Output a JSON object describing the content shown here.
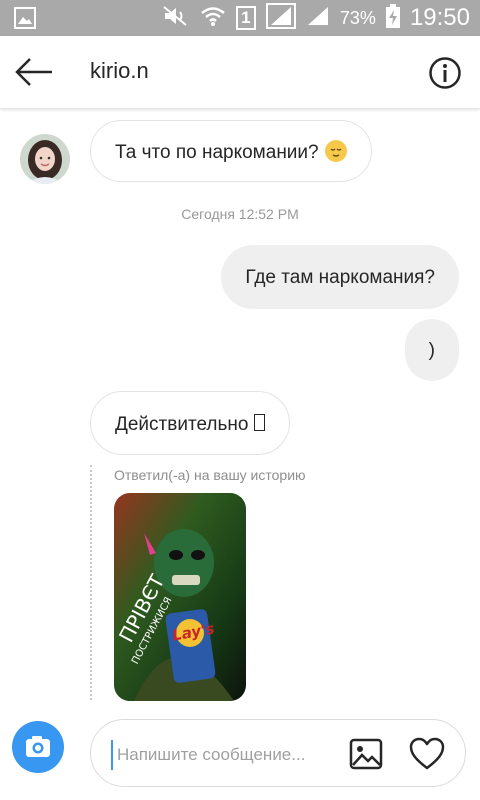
{
  "status_bar": {
    "battery_percent": "73%",
    "time": "19:50",
    "sim_slot": "1",
    "icons": [
      "image-icon",
      "mute-icon",
      "wifi-icon",
      "sim-icon",
      "signal-icon",
      "signal-icon",
      "battery-charging-icon"
    ]
  },
  "header": {
    "username": "kirio.n",
    "icons": [
      "back-arrow-icon",
      "info-icon"
    ]
  },
  "messages": [
    {
      "sender": "other",
      "text": "Та что по наркомании?"
    },
    {
      "type": "timestamp",
      "text": "Сегодня 12:52 PM"
    },
    {
      "sender": "me",
      "text": "Где там наркомания?"
    },
    {
      "sender": "me",
      "text": ")"
    },
    {
      "sender": "other",
      "text": "Действительно"
    }
  ],
  "story_reply": {
    "label": "Ответил(-а) на вашу историю",
    "story_text_line1": "ПРІВЄТ",
    "story_text_line2": "ПОСТРИЖИСЯ",
    "story_brand": "Lay's"
  },
  "composer": {
    "placeholder": "Напишите сообщение...",
    "value": "",
    "icons": [
      "camera-icon",
      "gallery-icon",
      "heart-icon"
    ]
  },
  "colors": {
    "status_bar": "#a9a9a9",
    "accent": "#3897f0",
    "outgoing_bubble": "#efefef",
    "incoming_border": "#e3e3e3",
    "muted_text": "#999999"
  }
}
